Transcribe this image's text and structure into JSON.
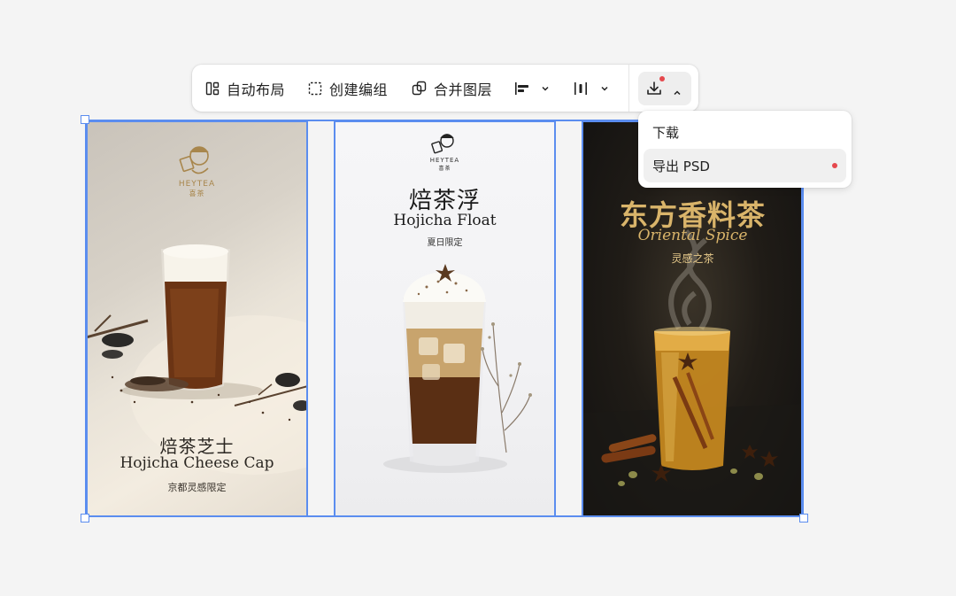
{
  "toolbar": {
    "auto_layout": {
      "icon": "auto-layout-icon",
      "label": "自动布局"
    },
    "create_group": {
      "icon": "dashed-frame-icon",
      "label": "创建编组"
    },
    "merge_layers": {
      "icon": "merge-layers-icon",
      "label": "合并图层"
    },
    "align": {
      "icon": "align-left-icon"
    },
    "distribute": {
      "icon": "distribute-icon"
    },
    "export": {
      "icon": "download-icon",
      "has_notification": true
    }
  },
  "dropdown": {
    "items": [
      {
        "label": "下载",
        "active": false
      },
      {
        "label": "导出 PSD",
        "active": true,
        "has_notification": true
      }
    ]
  },
  "posters": [
    {
      "brand": "HEYTEA",
      "brand_cn": "喜茶",
      "title_cn": "焙茶芝士",
      "title_en": "Hojicha Cheese Cap",
      "subtitle": "京都灵感限定"
    },
    {
      "brand": "HEYTEA",
      "brand_cn": "喜茶",
      "title_cn": "焙茶浮",
      "title_en": "Hojicha Float",
      "subtitle": "夏日限定"
    },
    {
      "title_cn": "东方香料茶",
      "title_en": "Oriental Spice",
      "subtitle": "灵感之茶"
    }
  ],
  "colors": {
    "selection": "#5b8def",
    "notification": "#e5484d",
    "gold_text": "#d9b46a",
    "brand_gold": "#a8864c"
  }
}
